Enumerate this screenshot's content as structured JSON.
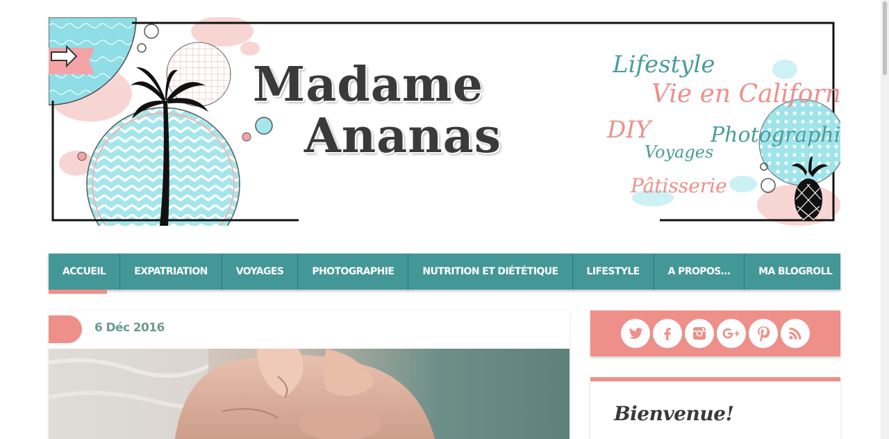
{
  "header": {
    "title_line1": "Madame",
    "title_line2": "Ananas",
    "tags": {
      "lifestyle": "Lifestyle",
      "vie": "Vie en Californie",
      "diy": "DIY",
      "photographie": "Photographie",
      "voyages": "Voyages",
      "patisserie": "Pâtisserie"
    },
    "icons": [
      "palm-tree-icon",
      "pineapple-icon",
      "arrow-icon"
    ]
  },
  "nav": {
    "items": [
      {
        "label": "Accueil",
        "active": true
      },
      {
        "label": "Expatriation"
      },
      {
        "label": "Voyages"
      },
      {
        "label": "Photographie"
      },
      {
        "label": "Nutrition et diététique"
      },
      {
        "label": "Lifestyle"
      },
      {
        "label": "A propos…"
      },
      {
        "label": "Ma blogroll"
      }
    ]
  },
  "post": {
    "date": "6 Déc 2016"
  },
  "sidebar": {
    "social_icons": [
      "twitter-icon",
      "facebook-icon",
      "instagram-icon",
      "google-plus-icon",
      "pinterest-icon",
      "rss-icon"
    ],
    "widget_title": "Bienvenue!"
  },
  "colors": {
    "teal": "#449797",
    "coral": "#ee8f8a",
    "dark_text": "#3a3a3a",
    "date_green": "#6b9c8c"
  }
}
